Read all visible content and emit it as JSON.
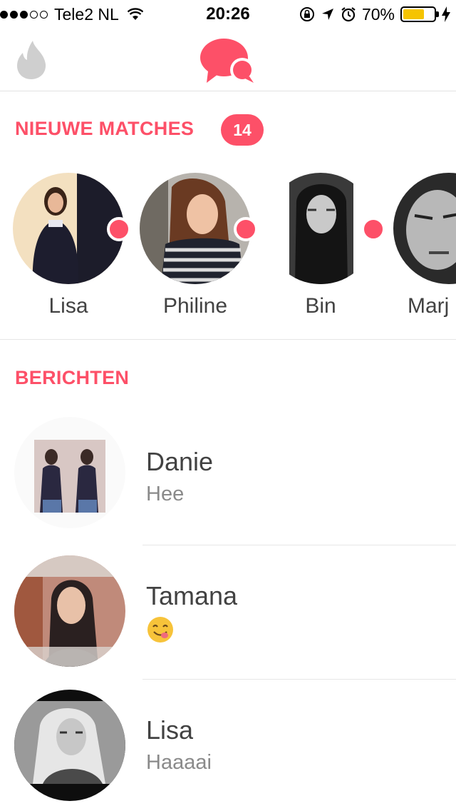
{
  "status_bar": {
    "carrier": "Tele2 NL",
    "time": "20:26",
    "battery_percent": "70%",
    "battery_level": 0.7,
    "signal_bars": 3
  },
  "nav": {
    "left_icon": "flame-icon",
    "center_icon": "chat-bubbles-icon"
  },
  "matches": {
    "title": "NIEUWE MATCHES",
    "count": "14",
    "items": [
      {
        "name": "Lisa",
        "unread": true
      },
      {
        "name": "Philine",
        "unread": true
      },
      {
        "name": "Bin",
        "unread": true
      },
      {
        "name": "Marj",
        "unread": false
      }
    ]
  },
  "messages": {
    "title": "BERICHTEN",
    "items": [
      {
        "name": "Danie",
        "text": "Hee"
      },
      {
        "name": "Tamana",
        "text": "",
        "emoji": "yum-face"
      },
      {
        "name": "Lisa",
        "text": "Haaaai"
      }
    ]
  },
  "colors": {
    "accent": "#fd5068",
    "icon_gray": "#cfcfcf",
    "battery": "#f5c400"
  }
}
